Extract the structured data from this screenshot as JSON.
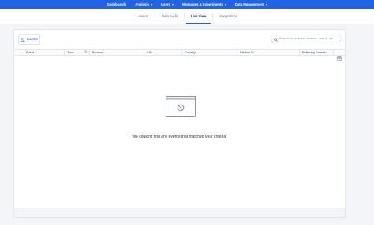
{
  "topnav": {
    "items": [
      {
        "label": "Dashboards",
        "has_caret": false
      },
      {
        "label": "Analysis",
        "has_caret": true
      },
      {
        "label": "Users",
        "has_caret": true
      },
      {
        "label": "Messages & Experiments",
        "has_caret": true
      },
      {
        "label": "Data Management",
        "has_caret": true
      }
    ]
  },
  "subnav": {
    "tabs": [
      {
        "label": "Lexicon"
      },
      {
        "label": "Data Audit"
      },
      {
        "label": "Live View",
        "active": true
      },
      {
        "label": "Integrations"
      }
    ]
  },
  "toolbar": {
    "filter_label": "FILTER",
    "search_placeholder": "Search for an email address, user id, etc.",
    "search_value": ""
  },
  "table": {
    "columns": [
      {
        "label": "Event"
      },
      {
        "label": "Time",
        "sortable": true
      },
      {
        "label": "Browser"
      },
      {
        "label": "City"
      },
      {
        "label": "Country"
      },
      {
        "label": "Distinct ID"
      },
      {
        "label": "Referring Domain"
      }
    ],
    "rows": []
  },
  "empty_state": {
    "message": "We couldn't find any events that matched your criteria."
  },
  "colors": {
    "brand_blue": "#1f63e9",
    "text": "#2b2f3a",
    "border": "#e2e5eb"
  }
}
